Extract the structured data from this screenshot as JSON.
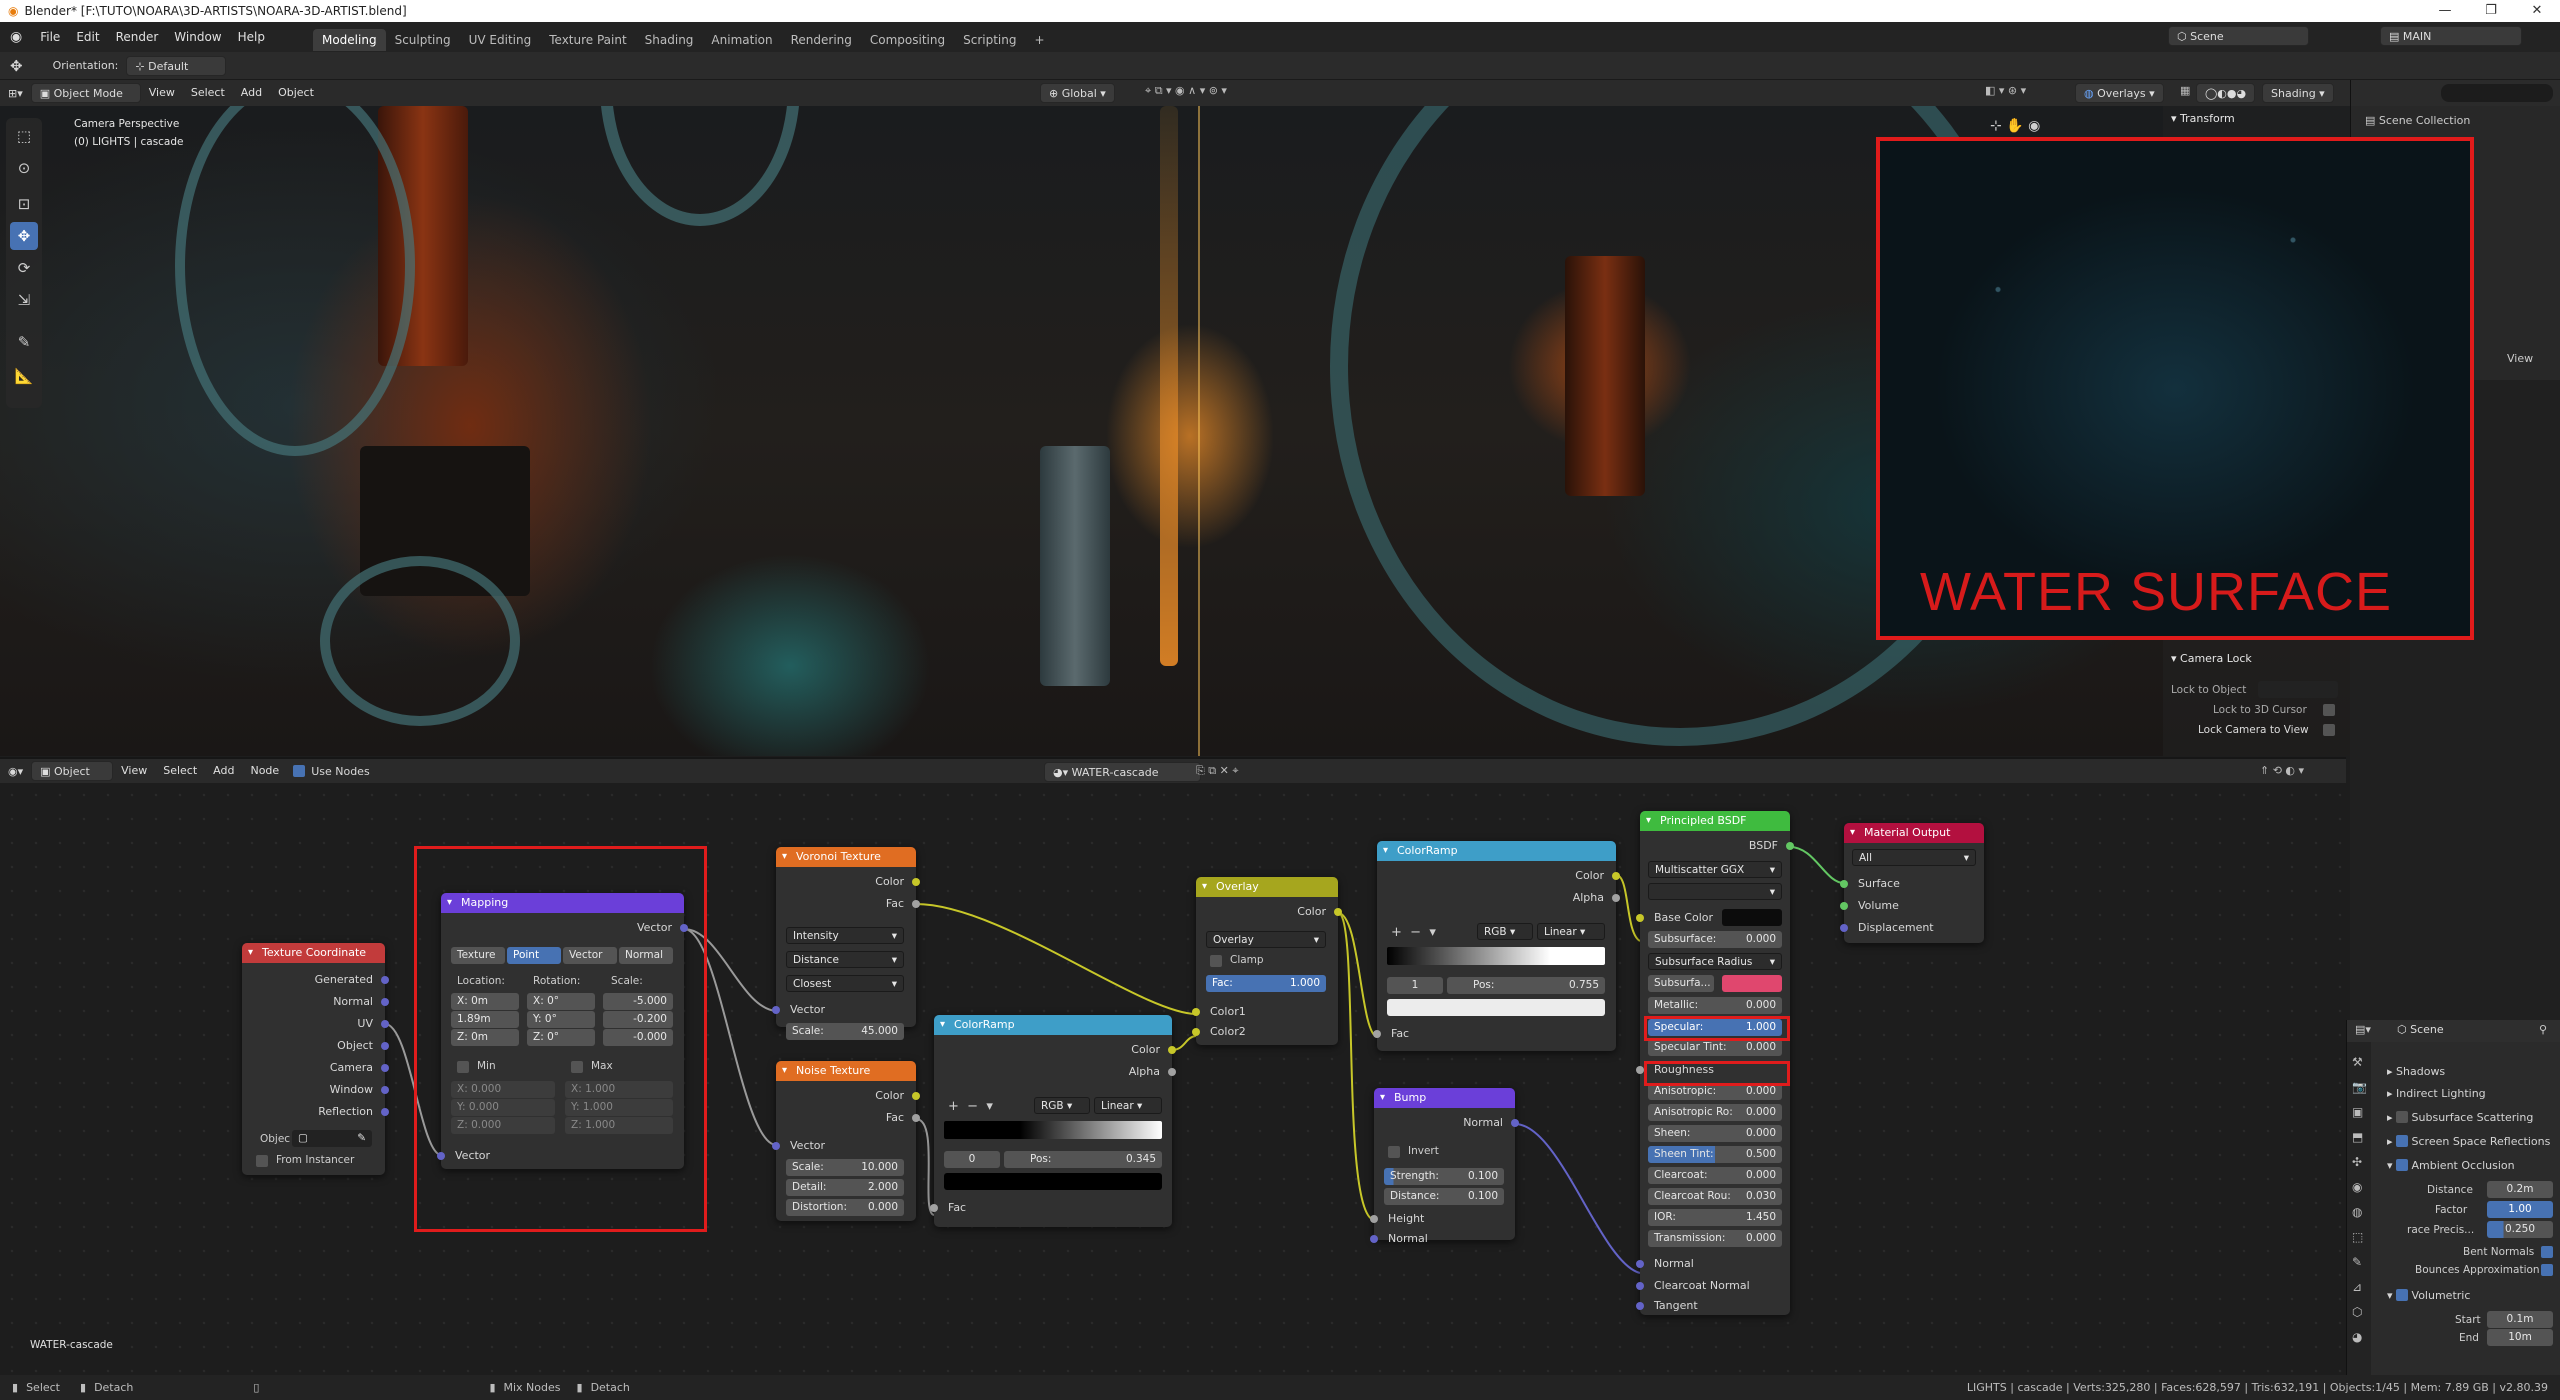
{
  "window": {
    "title": "Blender* [F:\\TUTO\\NOARA\\3D-ARTISTS\\NOARA-3D-ARTIST.blend]",
    "minimize": "—",
    "restore": "❐",
    "close": "✕"
  },
  "menus": [
    "File",
    "Edit",
    "Render",
    "Window",
    "Help"
  ],
  "workspaces": [
    "Modeling",
    "Sculpting",
    "UV Editing",
    "Texture Paint",
    "Shading",
    "Animation",
    "Rendering",
    "Compositing",
    "Scripting",
    "+"
  ],
  "scene": {
    "name": "Scene",
    "view_layer": "MAIN"
  },
  "toolheader": {
    "orientation_label": "Orientation:",
    "orientation_value": "Default"
  },
  "viewport": {
    "mode": "Object Mode",
    "menus": [
      "View",
      "Select",
      "Add",
      "Object"
    ],
    "transform_orientation": "Global",
    "overlays": "Overlays",
    "shading": "Shading",
    "info_line1": "Camera Perspective",
    "info_line2": "(0) LIGHTS | cascade",
    "overlay_label": "WATER SURFACE"
  },
  "npanel": {
    "transform": "Transform",
    "camera_lock": "Camera Lock",
    "lock_to_object": "Lock to Object",
    "lock_to_cursor": "Lock to 3D Cursor",
    "lock_camera": "Lock Camera to View",
    "tab_view": "View"
  },
  "outliner": {
    "title": "Scene Collection"
  },
  "node_editor": {
    "object": "Object",
    "menus": [
      "View",
      "Select",
      "Add",
      "Node"
    ],
    "use_nodes": "Use Nodes",
    "material": "WATER-cascade",
    "footer_label": "WATER-cascade"
  },
  "nodes": {
    "texcoord": {
      "title": "Texture Coordinate",
      "outputs": [
        "Generated",
        "Normal",
        "UV",
        "Object",
        "Camera",
        "Window",
        "Reflection"
      ],
      "object_label": "Objec",
      "from_instancer": "From Instancer"
    },
    "mapping": {
      "title": "Mapping",
      "output": "Vector",
      "types": [
        "Texture",
        "Point",
        "Vector",
        "Normal"
      ],
      "location_label": "Location:",
      "rotation_label": "Rotation:",
      "scale_label": "Scale:",
      "loc": [
        "X: 0m",
        "1.89m",
        "Z: 0m"
      ],
      "rot": [
        "X: 0°",
        "Y: 0°",
        "Z: 0°"
      ],
      "scale": [
        "-5.000",
        "-0.200",
        "-0.000"
      ],
      "min": "Min",
      "max": "Max",
      "min_vals": [
        "X: 0.000",
        "Y: 0.000",
        "Z: 0.000"
      ],
      "max_vals": [
        "X: 1.000",
        "Y: 1.000",
        "Z: 1.000"
      ],
      "input": "Vector"
    },
    "voronoi": {
      "title": "Voronoi Texture",
      "outputs": [
        "Color",
        "Fac"
      ],
      "dropdowns": [
        "Intensity",
        "Distance",
        "Closest"
      ],
      "vector": "Vector",
      "scale_label": "Scale:",
      "scale": "45.000"
    },
    "noise": {
      "title": "Noise Texture",
      "outputs": [
        "Color",
        "Fac"
      ],
      "vector": "Vector",
      "scale_label": "Scale:",
      "scale": "10.000",
      "detail_label": "Detail:",
      "detail": "2.000",
      "distortion_label": "Distortion:",
      "distortion": "0.000"
    },
    "ramp1": {
      "title": "ColorRamp",
      "outputs": [
        "Color",
        "Alpha"
      ],
      "mode": "RGB",
      "interp": "Linear",
      "index": "0",
      "pos_label": "Pos:",
      "pos": "0.345",
      "input": "Fac"
    },
    "overlay": {
      "title": "Overlay",
      "output": "Color",
      "blend": "Overlay",
      "clamp": "Clamp",
      "fac_label": "Fac:",
      "fac": "1.000",
      "inputs": [
        "Color1",
        "Color2"
      ]
    },
    "ramp2": {
      "title": "ColorRamp",
      "outputs": [
        "Color",
        "Alpha"
      ],
      "mode": "RGB",
      "interp": "Linear",
      "index": "1",
      "pos_label": "Pos:",
      "pos": "0.755",
      "input": "Fac"
    },
    "bump": {
      "title": "Bump",
      "output": "Normal",
      "invert": "Invert",
      "strength_label": "Strength:",
      "strength": "0.100",
      "distance_label": "Distance:",
      "distance": "0.100",
      "inputs": [
        "Height",
        "Normal"
      ]
    },
    "bsdf": {
      "title": "Principled BSDF",
      "output": "BSDF",
      "distribution": "Multiscatter GGX",
      "sss_method": "",
      "base_color": "Base Color",
      "rows": [
        {
          "label": "Subsurface:",
          "value": "0.000"
        },
        {
          "label": "Subsurface Radius",
          "value": ""
        },
        {
          "label": "Subsurfa...",
          "value": ""
        },
        {
          "label": "Metallic:",
          "value": "0.000"
        },
        {
          "label": "Specular:",
          "value": "1.000"
        },
        {
          "label": "Specular Tint:",
          "value": "0.000"
        },
        {
          "label": "Roughness",
          "value": ""
        },
        {
          "label": "Anisotropic:",
          "value": "0.000"
        },
        {
          "label": "Anisotropic Ro:",
          "value": "0.000"
        },
        {
          "label": "Sheen:",
          "value": "0.000"
        },
        {
          "label": "Sheen Tint:",
          "value": "0.500"
        },
        {
          "label": "Clearcoat:",
          "value": "0.000"
        },
        {
          "label": "Clearcoat Rou:",
          "value": "0.030"
        },
        {
          "label": "IOR:",
          "value": "1.450"
        },
        {
          "label": "Transmission:",
          "value": "0.000"
        }
      ],
      "vectors": [
        "Normal",
        "Clearcoat Normal",
        "Tangent"
      ]
    },
    "output": {
      "title": "Material Output",
      "target": "All",
      "inputs": [
        "Surface",
        "Volume",
        "Displacement"
      ]
    }
  },
  "properties": {
    "scene": "Scene",
    "sections": [
      "Shadows",
      "Indirect Lighting",
      "Subsurface Scattering",
      "Screen Space Reflections",
      "Ambient Occlusion"
    ],
    "ao_distance_label": "Distance",
    "ao_distance": "0.2m",
    "ao_factor_label": "Factor",
    "ao_factor": "1.00",
    "ao_trace_label": "race Precis...",
    "ao_trace": "0.250",
    "bent_normals": "Bent Normals",
    "bounces": "Bounces Approximation",
    "volumetric": "Volumetric",
    "vol_start_label": "Start",
    "vol_start": "0.1m",
    "vol_end_label": "End",
    "vol_end": "10m"
  },
  "status": {
    "select": "Select",
    "detach": "Detach",
    "mix": "Mix Nodes",
    "detach2": "Detach",
    "stats": "LIGHTS | cascade | Verts:325,280 | Faces:628,597 | Tris:632,191 | Objects:1/45 | Mem: 7.89 GB | v2.80.39"
  },
  "colors": {
    "accent": "#4772b3",
    "highlight_red": "#e01c1c",
    "header_input": "#c23b3b",
    "header_texture": "#e06d22",
    "header_converter": "#3e9ec8",
    "header_shader": "#3fbb3f",
    "header_vector": "#6b3fd9",
    "header_color": "#a6a61e",
    "header_output": "#b3103f"
  }
}
